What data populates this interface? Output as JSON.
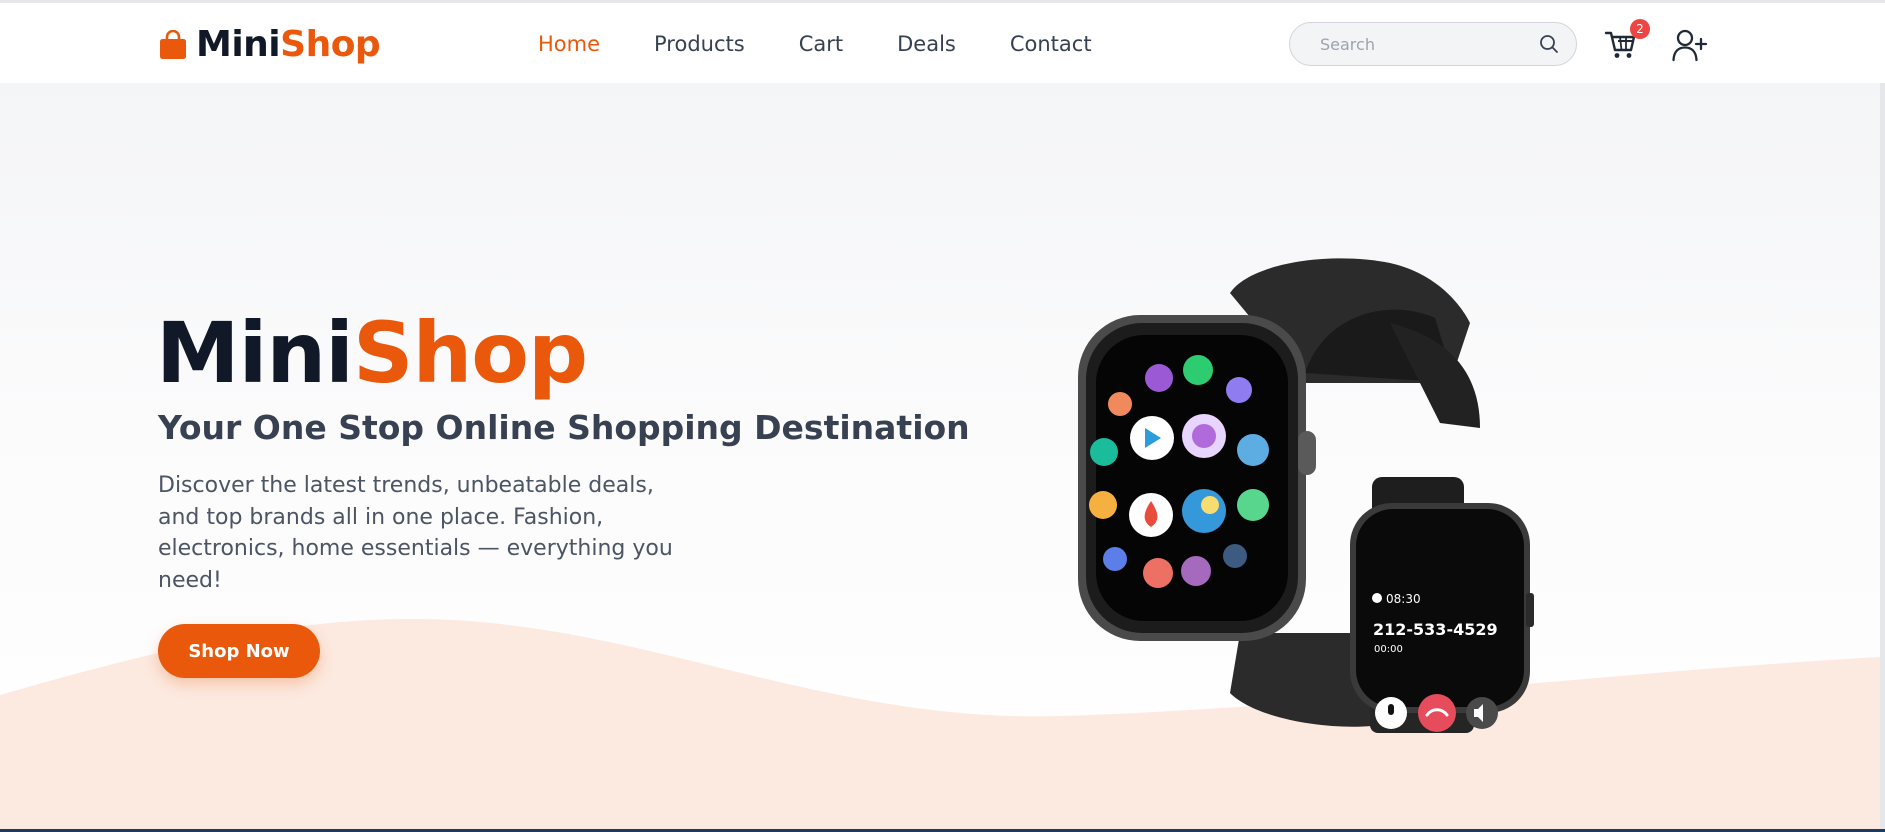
{
  "brand": {
    "name_part1": "Mini",
    "name_part2": "Shop",
    "accent_color": "#ea580c",
    "dark_color": "#111827",
    "icon": "shopping-bag-icon"
  },
  "nav": {
    "links": [
      {
        "label": "Home",
        "active": true
      },
      {
        "label": "Products",
        "active": false
      },
      {
        "label": "Cart",
        "active": false
      },
      {
        "label": "Deals",
        "active": false
      },
      {
        "label": "Contact",
        "active": false
      }
    ],
    "active_color": "#ea580c"
  },
  "search": {
    "placeholder": "Search",
    "icon": "search-icon"
  },
  "cart": {
    "icon": "cart-icon",
    "badge_count": "2",
    "badge_color": "#ef4444"
  },
  "account": {
    "icon": "add-user-icon"
  },
  "hero": {
    "title_part1": "Mini",
    "title_part2": "Shop",
    "subtitle": "Your One Stop Online Shopping Destination",
    "description": "Discover the latest trends, unbeatable deals, and top brands all in one place. Fashion, electronics, home essentials — everything you need!",
    "cta_label": "Shop Now",
    "wave_color": "#fce9df"
  },
  "watch_display": {
    "time": "08:30",
    "phone_number": "212-533-4529",
    "call_duration": "00:00"
  }
}
